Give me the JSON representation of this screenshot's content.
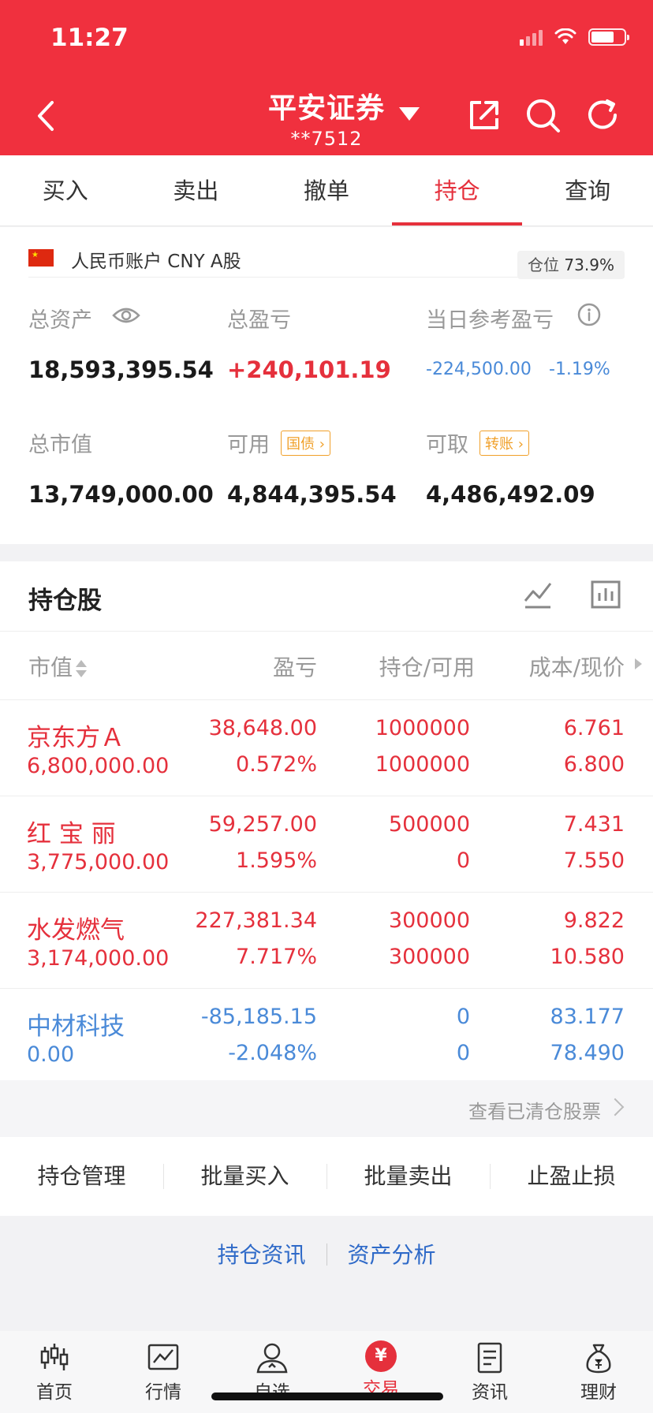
{
  "status_bar": {
    "time": "11:27"
  },
  "header": {
    "title": "平安证券",
    "account": "**7512",
    "bg_color": "#f0303e",
    "icons": [
      "back-icon",
      "share-icon",
      "search-icon",
      "refresh-icon"
    ]
  },
  "tabs": [
    {
      "label": "买入"
    },
    {
      "label": "卖出"
    },
    {
      "label": "撤单"
    },
    {
      "label": "持仓",
      "active": true
    },
    {
      "label": "查询"
    }
  ],
  "account": {
    "currency_label": "人民币账户 CNY A股",
    "position_ratio_label": "仓位",
    "position_ratio": "73.9%",
    "position_ratio_value": 0.739,
    "metrics": {
      "total_assets_label": "总资产",
      "total_assets": "18,593,395.54",
      "total_pl_label": "总盈亏",
      "total_pl": "+240,101.19",
      "daily_pl_label": "当日参考盈亏",
      "daily_pl": "-224,500.00",
      "daily_pl_pct": "-1.19%",
      "market_value_label": "总市值",
      "market_value": "13,749,000.00",
      "available_label": "可用",
      "available_tag": "国债",
      "available": "4,844,395.54",
      "withdrawable_label": "可取",
      "withdrawable_tag": "转账",
      "withdrawable": "4,486,492.09"
    }
  },
  "holdings": {
    "title": "持仓股",
    "columns": {
      "market_value": "市值",
      "pl": "盈亏",
      "position": "持仓/可用",
      "cost": "成本/现价"
    },
    "rows": [
      {
        "name": "京东方Ａ",
        "market_value": "6,800,000.00",
        "pl": "38,648.00",
        "pl_pct": "0.572%",
        "position": "1000000",
        "available": "1000000",
        "cost": "6.761",
        "price": "6.800",
        "tone": "red"
      },
      {
        "name": "红 宝 丽",
        "market_value": "3,775,000.00",
        "pl": "59,257.00",
        "pl_pct": "1.595%",
        "position": "500000",
        "available": "0",
        "cost": "7.431",
        "price": "7.550",
        "tone": "red"
      },
      {
        "name": "水发燃气",
        "market_value": "3,174,000.00",
        "pl": "227,381.34",
        "pl_pct": "7.717%",
        "position": "300000",
        "available": "300000",
        "cost": "9.822",
        "price": "10.580",
        "tone": "red"
      },
      {
        "name": "中材科技",
        "market_value": "0.00",
        "pl": "-85,185.15",
        "pl_pct": "-2.048%",
        "position": "0",
        "available": "0",
        "cost": "83.177",
        "price": "78.490",
        "tone": "blue"
      }
    ],
    "cleared_link": "查看已清仓股票"
  },
  "actions": [
    "持仓管理",
    "批量买入",
    "批量卖出",
    "止盈止损"
  ],
  "links": [
    "持仓资讯",
    "资产分析"
  ],
  "bottom_nav": [
    {
      "label": "首页",
      "icon": "candlestick-icon"
    },
    {
      "label": "行情",
      "icon": "chart-icon"
    },
    {
      "label": "自选",
      "icon": "user-star-icon"
    },
    {
      "label": "交易",
      "icon": "yuan-icon",
      "glyph": "¥",
      "active": true
    },
    {
      "label": "资讯",
      "icon": "news-icon"
    },
    {
      "label": "理财",
      "icon": "money-bag-icon"
    }
  ]
}
